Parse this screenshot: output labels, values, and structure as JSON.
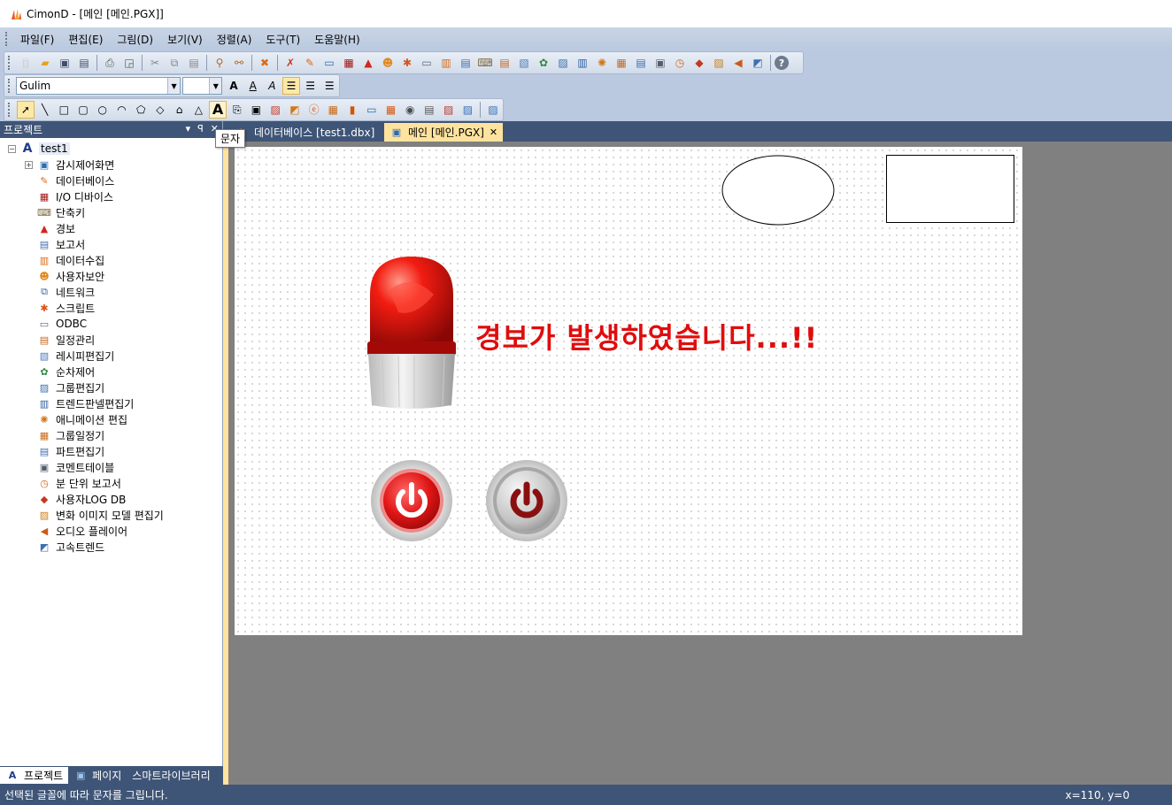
{
  "window": {
    "title": "CimonD - [메인 [메인.PGX]]"
  },
  "menu": [
    "파일(F)",
    "편집(E)",
    "그림(D)",
    "보기(V)",
    "정렬(A)",
    "도구(T)",
    "도움말(H)"
  ],
  "format_toolbar": {
    "font_name": "Gulim",
    "font_size": ""
  },
  "tooltip": "문자",
  "left_panel": {
    "title": "프로젝트",
    "root": "test1",
    "items": [
      {
        "label": "감시제어화면",
        "icon": "monitor-screen-icon",
        "color": "#2d6bb5",
        "glyph": "▣",
        "expandable": true
      },
      {
        "label": "데이터베이스",
        "icon": "pencil-database-icon",
        "color": "#e3681c",
        "glyph": "✎"
      },
      {
        "label": "I/O 디바이스",
        "icon": "io-device-icon",
        "color": "#a31515",
        "glyph": "▦"
      },
      {
        "label": "단축키",
        "icon": "shortcut-key-icon",
        "color": "#7f6a3d",
        "glyph": "⌨"
      },
      {
        "label": "경보",
        "icon": "alarm-icon",
        "color": "#d0281f",
        "glyph": "▲"
      },
      {
        "label": "보고서",
        "icon": "report-icon",
        "color": "#3d6fb2",
        "glyph": "▤"
      },
      {
        "label": "데이터수집",
        "icon": "data-collection-icon",
        "color": "#d66a1a",
        "glyph": "▥"
      },
      {
        "label": "사용자보안",
        "icon": "user-security-icon",
        "color": "#e08a1e",
        "glyph": "☻"
      },
      {
        "label": "네트워크",
        "icon": "network-icon",
        "color": "#3a6aa8",
        "glyph": "⧉"
      },
      {
        "label": "스크립트",
        "icon": "script-icon",
        "color": "#d9541a",
        "glyph": "✱"
      },
      {
        "label": "ODBC",
        "icon": "odbc-icon",
        "color": "#5b6a7e",
        "glyph": "▭"
      },
      {
        "label": "일정관리",
        "icon": "schedule-icon",
        "color": "#c8651b",
        "glyph": "▤"
      },
      {
        "label": "레시피편집기",
        "icon": "recipe-editor-icon",
        "color": "#4a7cba",
        "glyph": "▧"
      },
      {
        "label": "순차제어",
        "icon": "sequence-control-icon",
        "color": "#2f8a3c",
        "glyph": "✿"
      },
      {
        "label": "그룹편집기",
        "icon": "group-editor-icon",
        "color": "#3b70b0",
        "glyph": "▨"
      },
      {
        "label": "트렌드판넬편집기",
        "icon": "trend-panel-icon",
        "color": "#2c5e9e",
        "glyph": "▥"
      },
      {
        "label": "애니메이션 편집",
        "icon": "animation-editor-icon",
        "color": "#d0781d",
        "glyph": "✺"
      },
      {
        "label": "그룹일정기",
        "icon": "group-schedule-icon",
        "color": "#c86a1b",
        "glyph": "▦"
      },
      {
        "label": "파트편집기",
        "icon": "part-editor-icon",
        "color": "#3c6db0",
        "glyph": "▤"
      },
      {
        "label": "코멘트테이블",
        "icon": "comment-table-icon",
        "color": "#555e6e",
        "glyph": "▣"
      },
      {
        "label": "분 단위 보고서",
        "icon": "minute-report-icon",
        "color": "#d2671d",
        "glyph": "◷"
      },
      {
        "label": "사용자LOG DB",
        "icon": "user-log-db-icon",
        "color": "#c4391b",
        "glyph": "◆"
      },
      {
        "label": "변화 이미지 모델 편집기",
        "icon": "image-model-icon",
        "color": "#c97d1f",
        "glyph": "▨"
      },
      {
        "label": "오디오 플레이어",
        "icon": "audio-player-icon",
        "color": "#cc5a14",
        "glyph": "◀"
      },
      {
        "label": "고속트렌드",
        "icon": "fast-trend-icon",
        "color": "#3d6fb2",
        "glyph": "◩"
      }
    ],
    "tabs": [
      "프로젝트",
      "페이지",
      "스마트라이브러리"
    ]
  },
  "doc_tabs": [
    {
      "label": "데이터베이스 [test1.dbx]",
      "selected": false
    },
    {
      "label": "메인 [메인.PGX]",
      "selected": true
    }
  ],
  "canvas": {
    "alarm_message": "경보가 발생하였습니다...!!",
    "beacon_color": "#e8110f",
    "button_on_color": "#e01515",
    "button_off_color": "#8a1010"
  },
  "status": {
    "message": "선택된 글꼴에 따라 문자를 그립니다.",
    "coords": "x=110, y=0"
  }
}
